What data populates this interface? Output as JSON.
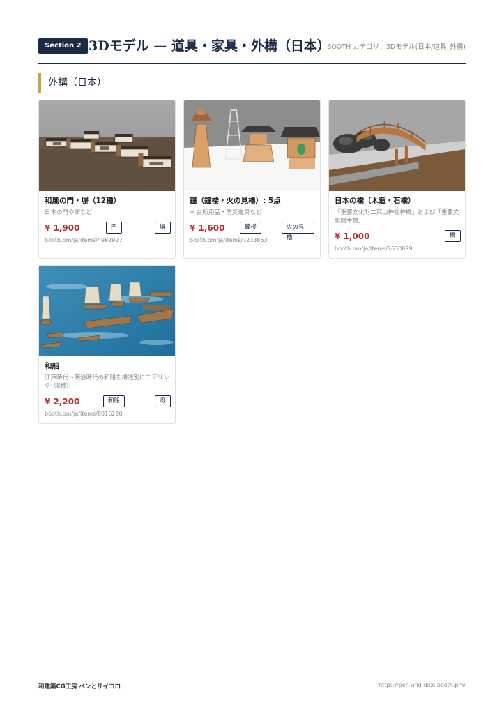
{
  "header": {
    "badge": "Section 2",
    "title": "3Dモデル — 道具・家具・外構（日本）",
    "category": "BOOTH カテゴリ：3Dモデル(日本/道具_外構)"
  },
  "subsection": {
    "title": "外構（日本）"
  },
  "items": [
    {
      "title": "和風の門・塀（12種）",
      "desc": "日本の門や塀など",
      "price": "¥ 1,900",
      "tags": [
        "門",
        "塀"
      ],
      "url": "booth.pm/ja/items/4982927",
      "thumb": "walls-gates-icon"
    },
    {
      "title": "鐘（鐘楼・火の見櫓）: 5点",
      "desc": "※ 台所用品・防災道具など",
      "price": "¥ 1,600",
      "tags": [
        "鐘楼",
        "火の見櫓"
      ],
      "url": "booth.pm/ja/items/7233863",
      "thumb": "bell-towers-icon"
    },
    {
      "title": "日本の橋（木造・石橋）",
      "desc": "「重要文化財二荒山神社神橋」および「重要文化財幸橋」",
      "price": "¥ 1,000",
      "tags": [
        "橋"
      ],
      "url": "booth.pm/ja/items/7630099",
      "thumb": "bridge-icon"
    },
    {
      "title": "和船",
      "desc": "江戸時代〜明治時代の和船を構造別にモデリング（8種）",
      "price": "¥ 2,200",
      "tags": [
        "和船",
        "舟"
      ],
      "url": "booth.pm/ja/items/8016220",
      "thumb": "boats-icon"
    }
  ],
  "footer": {
    "brand": "和建築CG工房 ペンとサイコロ",
    "url": "https://pen-and-dice.booth.pm/"
  },
  "colors": {
    "navy": "#1d2a44",
    "gold": "#c9a14a",
    "price_red": "#b5302f"
  }
}
